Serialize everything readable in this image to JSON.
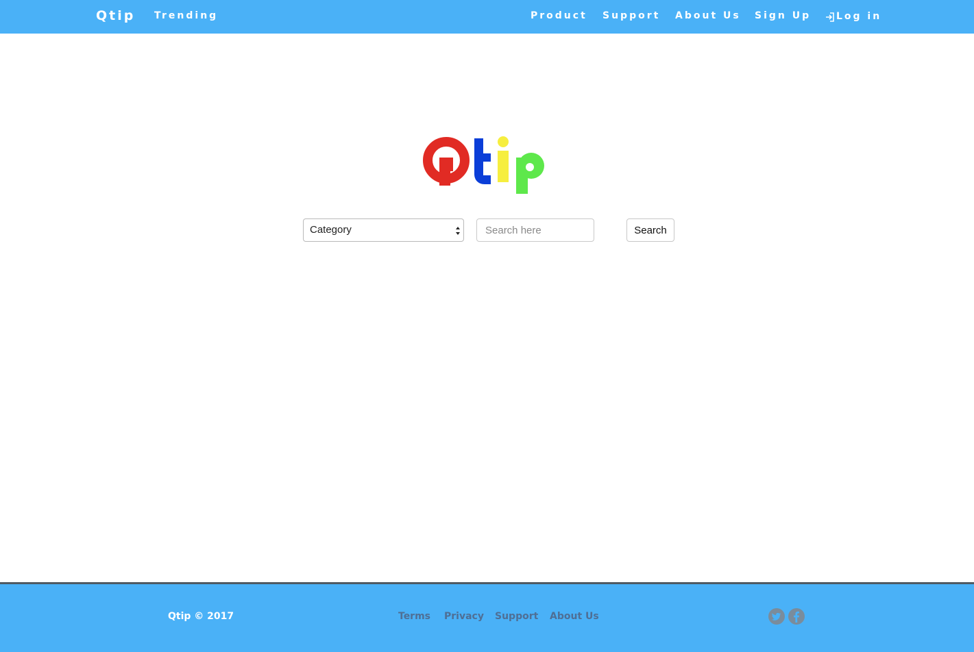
{
  "navbar": {
    "brand": "Qtip",
    "left_links": [
      {
        "label": "Trending"
      }
    ],
    "right_links": [
      {
        "label": "Product"
      },
      {
        "label": "Support"
      },
      {
        "label": "About Us"
      },
      {
        "label": "Sign Up"
      }
    ],
    "login": {
      "label": "Log in",
      "icon": "log-in-icon"
    },
    "color": "#4ab1f7"
  },
  "logo": {
    "text": "Qtip",
    "colors": {
      "Q": "#e12b24",
      "t": "#0b3ed8",
      "i": "#f6ee3f",
      "p": "#5ee84b"
    }
  },
  "search": {
    "category_select": {
      "selected": "Category"
    },
    "input": {
      "value": "",
      "placeholder": "Search here"
    },
    "button_label": "Search"
  },
  "footer": {
    "copyright": "Qtip © 2017",
    "links": [
      {
        "label": "Terms"
      },
      {
        "label": "Privacy"
      },
      {
        "label": "Support"
      },
      {
        "label": "About Us"
      }
    ],
    "social": [
      {
        "icon": "twitter-icon"
      },
      {
        "icon": "facebook-icon"
      }
    ],
    "color": "#4ab1f7",
    "link_color": "#4f6f95"
  }
}
